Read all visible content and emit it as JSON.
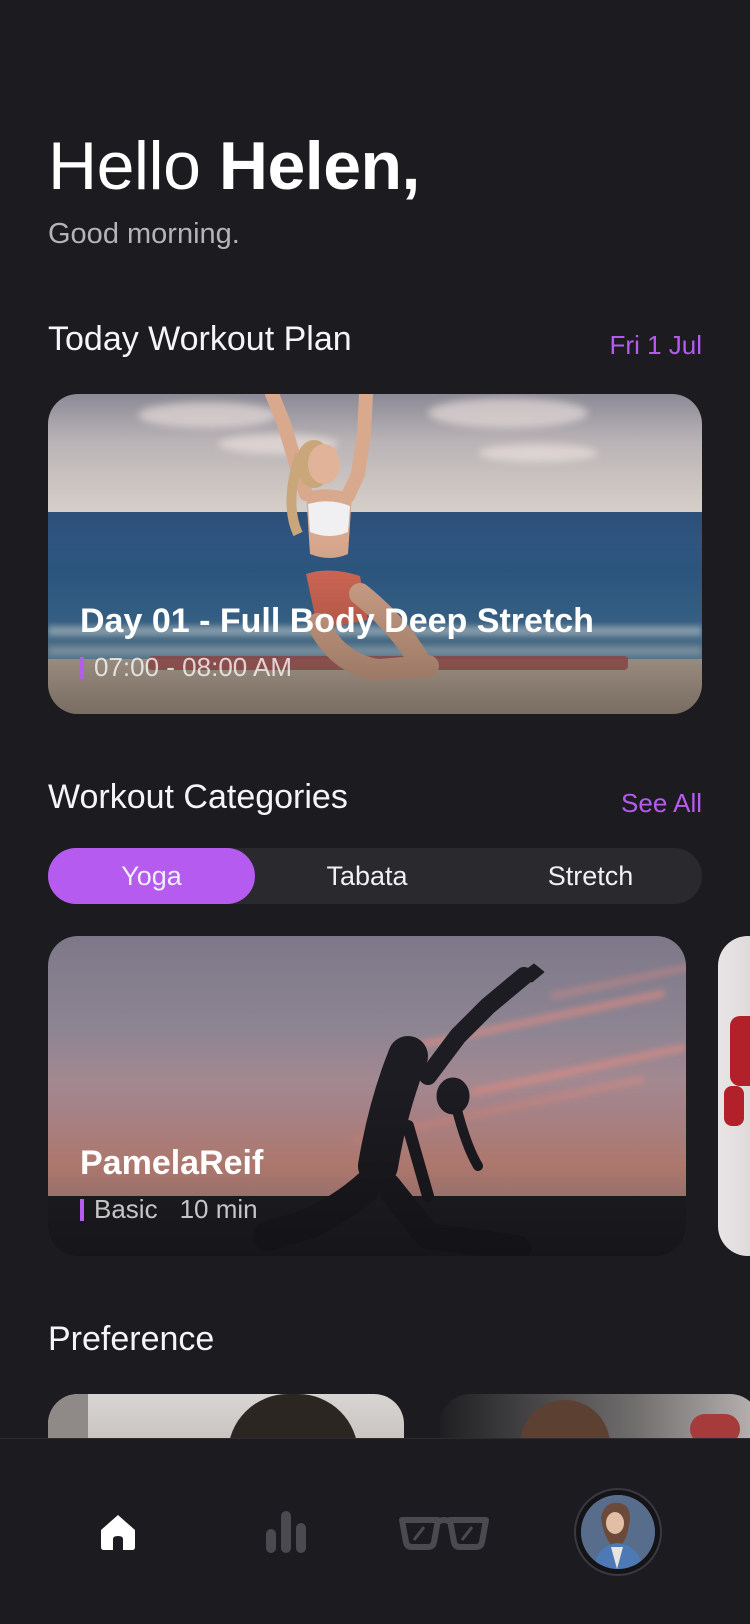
{
  "greeting": {
    "hello": "Hello",
    "name": "Helen,",
    "subtitle": "Good morning."
  },
  "today": {
    "title": "Today Workout Plan",
    "date": "Fri 1 Jul",
    "card": {
      "title": "Day 01 - Full Body Deep Stretch",
      "time": "07:00 - 08:00 AM"
    }
  },
  "categories": {
    "title": "Workout Categories",
    "see_all": "See All",
    "tabs": [
      "Yoga",
      "Tabata",
      "Stretch"
    ],
    "selected": "Yoga",
    "card": {
      "title": "PamelaReif",
      "level": "Basic",
      "duration": "10 min"
    }
  },
  "preference": {
    "title": "Preference"
  },
  "nav": {
    "items": [
      {
        "icon": "home-icon",
        "active": true
      },
      {
        "icon": "stats-icon",
        "active": false
      },
      {
        "icon": "glasses-icon",
        "active": false
      },
      {
        "icon": "profile-avatar",
        "active": false
      }
    ]
  },
  "colors": {
    "accent": "#b65bf0",
    "background": "#1c1b20",
    "segment_bg": "#2a292e"
  }
}
